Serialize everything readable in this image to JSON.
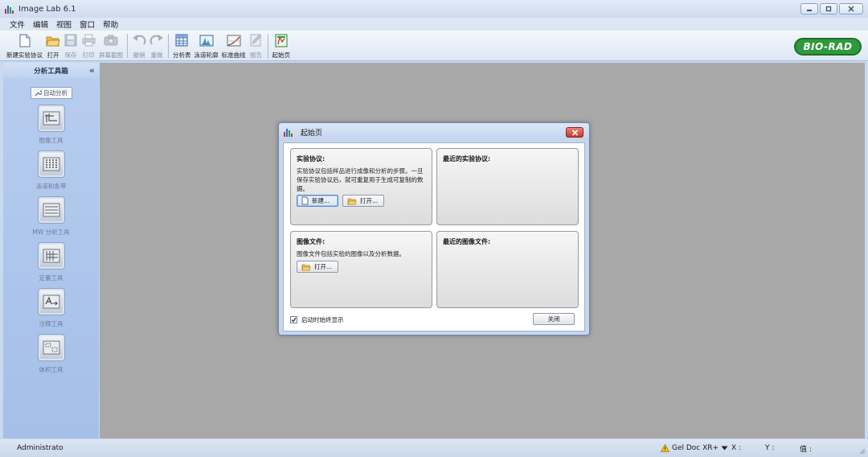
{
  "window": {
    "title": "Image Lab 6.1",
    "controls": [
      "minimize",
      "maximize",
      "close"
    ]
  },
  "menu": [
    "文件",
    "编辑",
    "视图",
    "窗口",
    "帮助"
  ],
  "toolbar": {
    "items": [
      {
        "label": "新建实验协议",
        "icon": "new-protocol-icon",
        "enabled": true
      },
      {
        "label": "打开",
        "icon": "open-folder-icon",
        "enabled": true
      },
      {
        "label": "保存",
        "icon": "save-icon",
        "enabled": false
      },
      {
        "label": "打印",
        "icon": "print-icon",
        "enabled": false
      },
      {
        "label": "屏幕截图",
        "icon": "screenshot-camera-icon",
        "enabled": false
      },
      {
        "label": "撤销",
        "icon": "undo-icon",
        "enabled": false
      },
      {
        "label": "重做",
        "icon": "redo-icon",
        "enabled": false
      },
      {
        "label": "分析表",
        "icon": "analysis-table-icon",
        "enabled": true
      },
      {
        "label": "泳道轮廓",
        "icon": "lane-profile-icon",
        "enabled": true
      },
      {
        "label": "标准曲线",
        "icon": "standard-curve-icon",
        "enabled": true
      },
      {
        "label": "报告",
        "icon": "report-icon",
        "enabled": false
      },
      {
        "label": "起始页",
        "icon": "start-page-icon",
        "enabled": true
      }
    ],
    "logo_text": "BIO-RAD"
  },
  "left_panel": {
    "title": "分析工具箱",
    "auto_analysis": "自动分析",
    "tools": [
      {
        "label": "图像工具",
        "icon": "image-tools-icon"
      },
      {
        "label": "泳道和条带",
        "icon": "lanes-bands-icon"
      },
      {
        "label": "MW 分析工具",
        "icon": "mw-analysis-icon"
      },
      {
        "label": "定量工具",
        "icon": "quantity-tools-icon"
      },
      {
        "label": "注释工具",
        "icon": "annotation-tools-icon"
      },
      {
        "label": "体积工具",
        "icon": "volume-tools-icon"
      }
    ]
  },
  "dialog": {
    "title": "起始页",
    "protocol": {
      "title": "实验协议:",
      "desc": "实验协议包括样品进行成像和分析的步骤。一旦保存实验协议后，就可重复用于生成可复制的数据。",
      "new_label": "新建...",
      "open_label": "打开..."
    },
    "recent_protocols": {
      "title": "最近的实验协议:"
    },
    "image_files": {
      "title": "图像文件:",
      "desc": "图像文件包括实验的图像以及分析数据。",
      "open_label": "打开..."
    },
    "recent_images": {
      "title": "最近的图像文件:"
    },
    "show_on_startup": {
      "label": "启动时始终显示",
      "checked": true
    },
    "close_label": "关闭"
  },
  "status": {
    "user": "Administrato",
    "instrument": "Gel Doc XR+",
    "x_label": "X :",
    "y_label": "Y :",
    "value_label": "值 :"
  }
}
